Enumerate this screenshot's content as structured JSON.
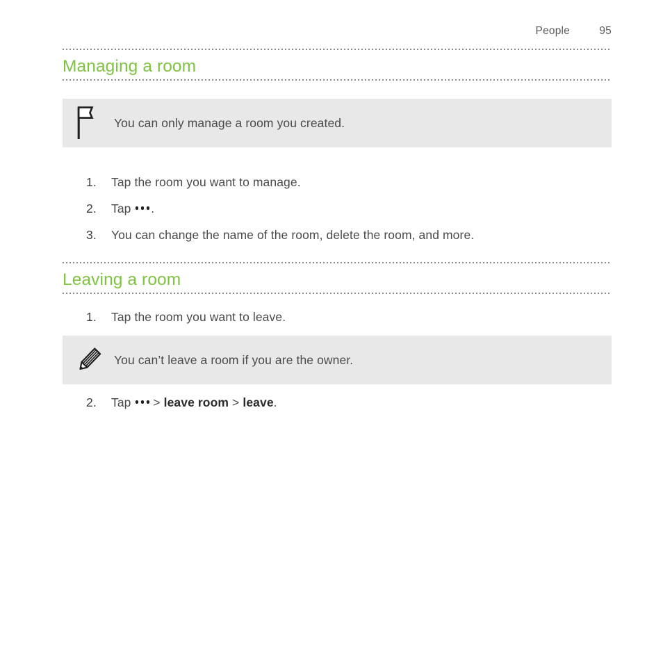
{
  "header": {
    "section": "People",
    "page_number": "95"
  },
  "sections": [
    {
      "heading": "Managing a room",
      "note": {
        "icon": "flag-icon",
        "text": "You can only manage a room you created."
      },
      "steps": [
        {
          "num": "1.",
          "text": "Tap the room you want to manage."
        },
        {
          "num": "2.",
          "prefix": "Tap",
          "glyph": "more-options-dots-icon",
          "suffix": "."
        },
        {
          "num": "3.",
          "text": "You can change the name of the room, delete the room, and more."
        }
      ]
    },
    {
      "heading": "Leaving a room",
      "steps_before_note": [
        {
          "num": "1.",
          "text": "Tap the room you want to leave."
        }
      ],
      "note": {
        "icon": "pencil-icon",
        "text": "You can’t leave a room if you are the owner."
      },
      "steps_after_note": [
        {
          "num": "2.",
          "prefix": "Tap",
          "glyph": "more-options-dots-icon",
          "sep1": ">",
          "label1": "leave room",
          "sep2": ">",
          "label2": "leave",
          "suffix": "."
        }
      ]
    }
  ],
  "colors": {
    "heading_green": "#80c342",
    "note_background": "#e8e8e8",
    "body_text": "#4a4a4a",
    "rule_gray": "#8c8c8c"
  }
}
